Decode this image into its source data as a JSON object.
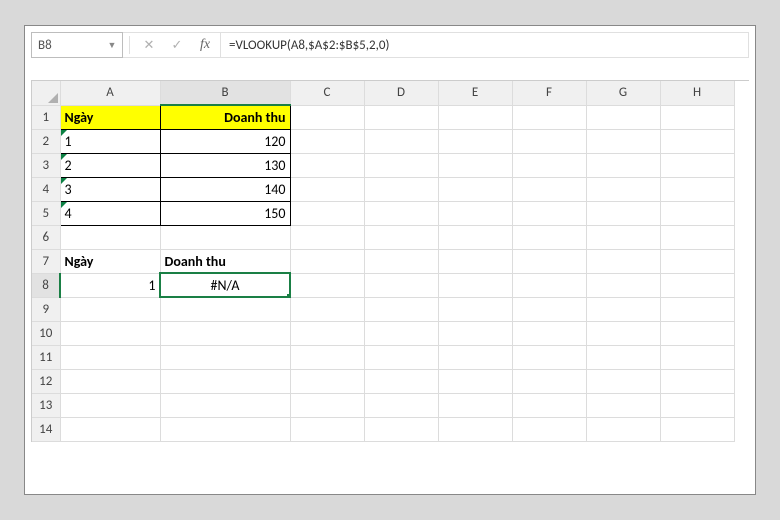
{
  "formula_bar": {
    "name_box": "B8",
    "fx_label": "fx",
    "formula": "=VLOOKUP(A8,$A$2:$B$5,2,0)"
  },
  "columns": [
    "A",
    "B",
    "C",
    "D",
    "E",
    "F",
    "G",
    "H"
  ],
  "rows": [
    "1",
    "2",
    "3",
    "4",
    "5",
    "6",
    "7",
    "8",
    "9",
    "10",
    "11",
    "12",
    "13",
    "14"
  ],
  "active": {
    "col": "B",
    "row": "8"
  },
  "cells": {
    "A1": {
      "v": "Ngày",
      "cls": "header-yellow"
    },
    "B1": {
      "v": "Doanh thu",
      "cls": "header-yellow right"
    },
    "A2": {
      "v": "1",
      "cls": "data-box left err"
    },
    "B2": {
      "v": "120",
      "cls": "data-box right"
    },
    "A3": {
      "v": "2",
      "cls": "data-box left err"
    },
    "B3": {
      "v": "130",
      "cls": "data-box right"
    },
    "A4": {
      "v": "3",
      "cls": "data-box left err"
    },
    "B4": {
      "v": "140",
      "cls": "data-box right"
    },
    "A5": {
      "v": "4",
      "cls": "data-box left err"
    },
    "B5": {
      "v": "150",
      "cls": "data-box right"
    },
    "A7": {
      "v": "Ngày",
      "cls": "bold"
    },
    "B7": {
      "v": "Doanh thu",
      "cls": "bold"
    },
    "A8": {
      "v": "1",
      "cls": "right"
    },
    "B8": {
      "v": "#N/A",
      "cls": "active center"
    }
  }
}
